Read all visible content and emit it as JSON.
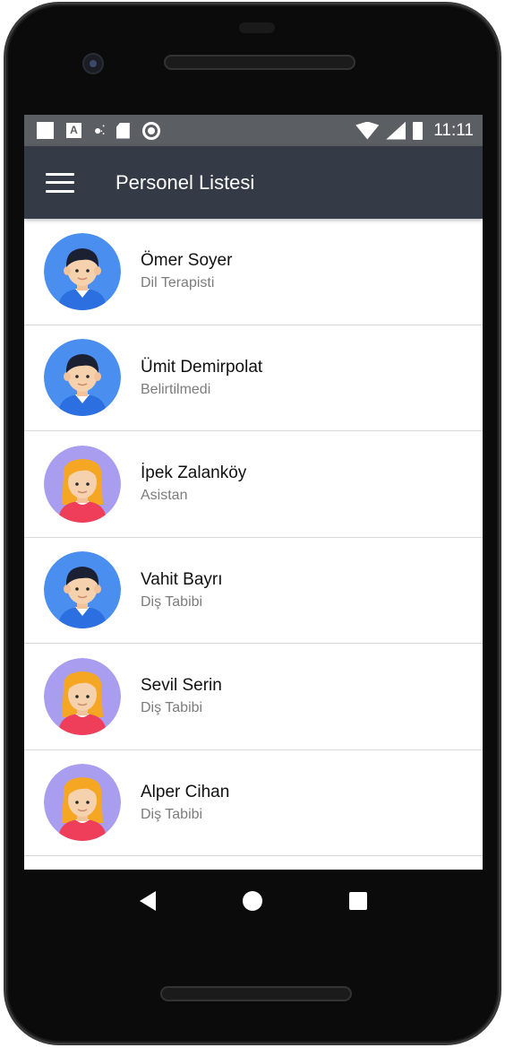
{
  "status_bar": {
    "time": "11:11",
    "left_icons": [
      "square-icon",
      "a-icon",
      "dots-icon",
      "sd-card-icon",
      "circle-icon"
    ],
    "right_icons": [
      "wifi-icon",
      "signal-icon",
      "battery-icon"
    ]
  },
  "app_bar": {
    "title": "Personel Listesi",
    "menu_icon": "hamburger-menu-icon",
    "background": "#343a46"
  },
  "personnel": [
    {
      "name": "Ömer Soyer",
      "role": "Dil Terapisti",
      "avatar": "male-avatar"
    },
    {
      "name": "Ümit Demirpolat",
      "role": "Belirtilmedi",
      "avatar": "male-avatar"
    },
    {
      "name": "İpek Zalanköy",
      "role": "Asistan",
      "avatar": "female-avatar"
    },
    {
      "name": "Vahit Bayrı",
      "role": "Diş Tabibi",
      "avatar": "male-avatar"
    },
    {
      "name": "Sevil Serin",
      "role": "Diş Tabibi",
      "avatar": "female-avatar"
    },
    {
      "name": "Alper Cihan",
      "role": "Diş Tabibi",
      "avatar": "female-avatar"
    }
  ],
  "colors": {
    "male_avatar_bg": "#4a8ff0",
    "female_avatar_bg": "#a99df0",
    "status_bar": "#5b5e63"
  },
  "nav_bar": {
    "icons": [
      "back-icon",
      "home-icon",
      "recents-icon"
    ]
  }
}
